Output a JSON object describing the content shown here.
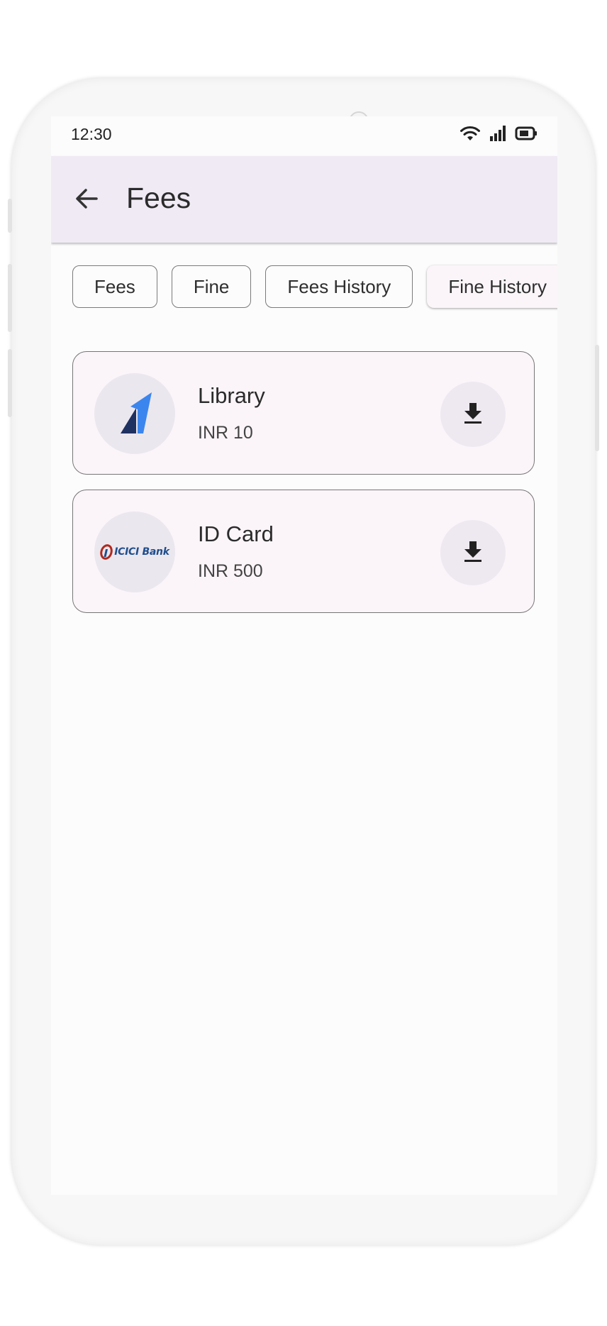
{
  "status_bar": {
    "time": "12:30",
    "icons": [
      "wifi-icon",
      "signal-icon",
      "battery-icon"
    ]
  },
  "app_bar": {
    "title": "Fees",
    "back_icon": "arrow-back-icon",
    "background": "#efeaf4"
  },
  "tabs": [
    {
      "label": "Fees",
      "selected": false
    },
    {
      "label": "Fine",
      "selected": false
    },
    {
      "label": "Fees History",
      "selected": false
    },
    {
      "label": "Fine History",
      "selected": true
    }
  ],
  "items": [
    {
      "title": "Library",
      "amount": "INR 10",
      "logo": "library-logo",
      "action_icon": "download-icon"
    },
    {
      "title": "ID Card",
      "amount": "INR 500",
      "logo": "icici-bank-logo",
      "logo_text": "ICICI Bank",
      "action_icon": "download-icon"
    }
  ],
  "colors": {
    "card_background": "#fbf5f9",
    "icici_red": "#b02a1e",
    "icici_blue": "#1f4e8c",
    "library_logo_dark": "#1f3160",
    "library_logo_light": "#3b86ee"
  }
}
